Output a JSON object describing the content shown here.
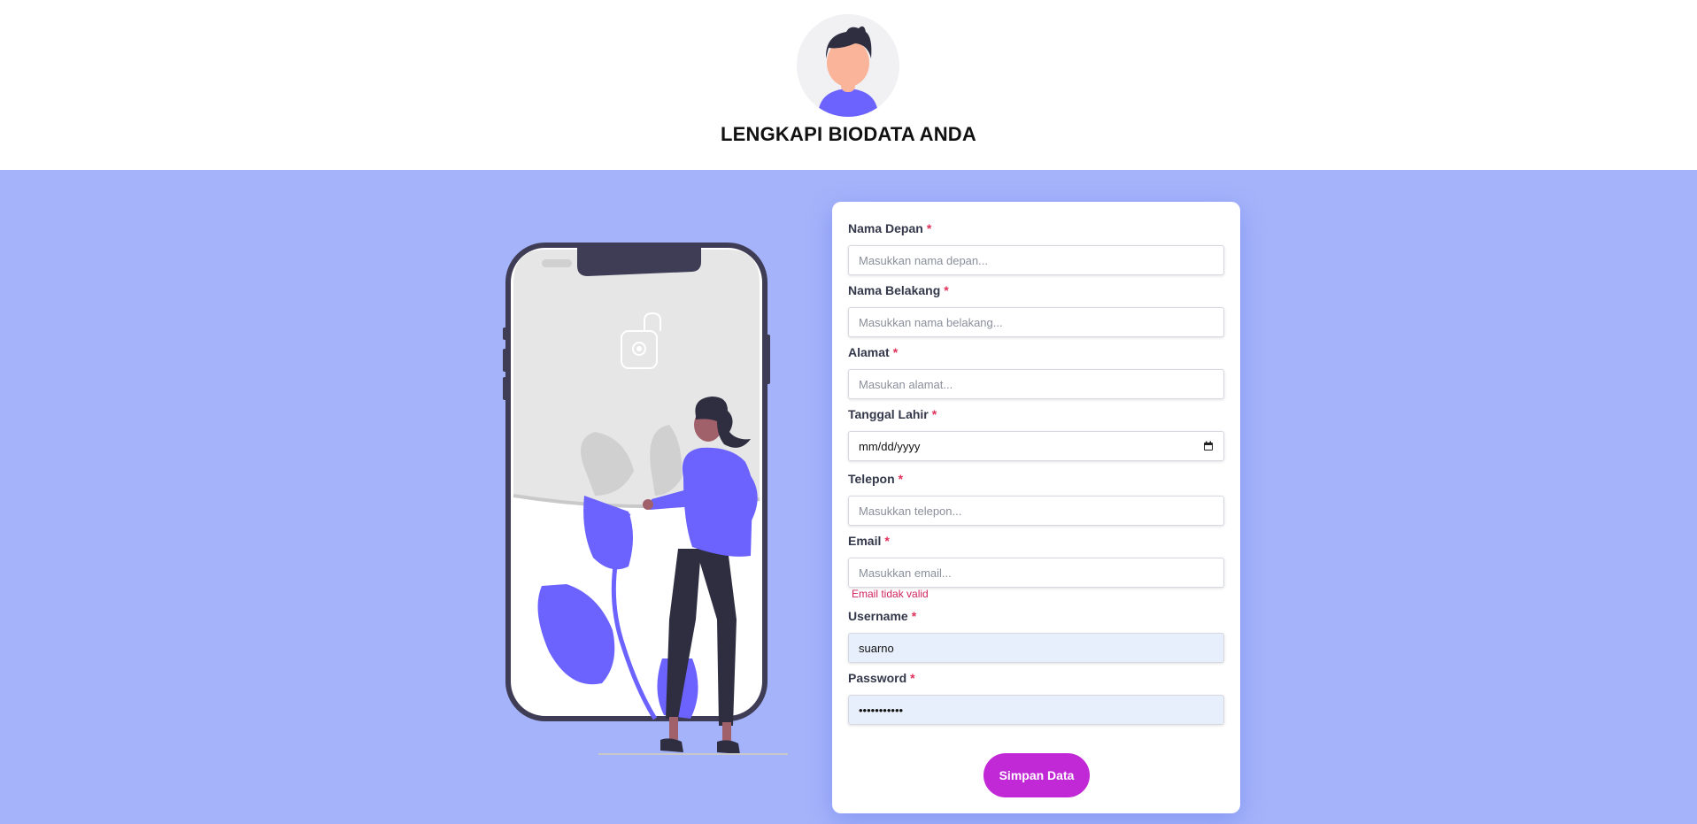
{
  "header": {
    "title": "LENGKAPI BIODATA ANDA",
    "avatar_icon": "user-avatar-icon"
  },
  "form": {
    "fields": [
      {
        "label": "Nama Depan",
        "required": "*",
        "placeholder": "Masukkan nama depan...",
        "value": ""
      },
      {
        "label": "Nama Belakang",
        "required": "*",
        "placeholder": "Masukkan nama belakang...",
        "value": ""
      },
      {
        "label": "Alamat",
        "required": "*",
        "placeholder": "Masukan alamat...",
        "value": ""
      },
      {
        "label": "Tanggal Lahir",
        "required": "*",
        "placeholder": "mm/dd/yyyy",
        "value": "",
        "icon": "calendar-icon"
      },
      {
        "label": "Telepon",
        "required": "*",
        "placeholder": "Masukkan telepon...",
        "value": ""
      },
      {
        "label": "Email",
        "required": "*",
        "placeholder": "Masukkan email...",
        "value": "",
        "error": "Email tidak valid"
      },
      {
        "label": "Username",
        "required": "*",
        "placeholder": "",
        "value": "suarno"
      },
      {
        "label": "Password",
        "required": "*",
        "placeholder": "",
        "value": "•••••••••••"
      }
    ],
    "submit_label": "Simpan Data"
  },
  "colors": {
    "background": "#a5b3fa",
    "accent": "#c128d6",
    "illustration_primary": "#6c63ff",
    "error": "#d0245c"
  }
}
